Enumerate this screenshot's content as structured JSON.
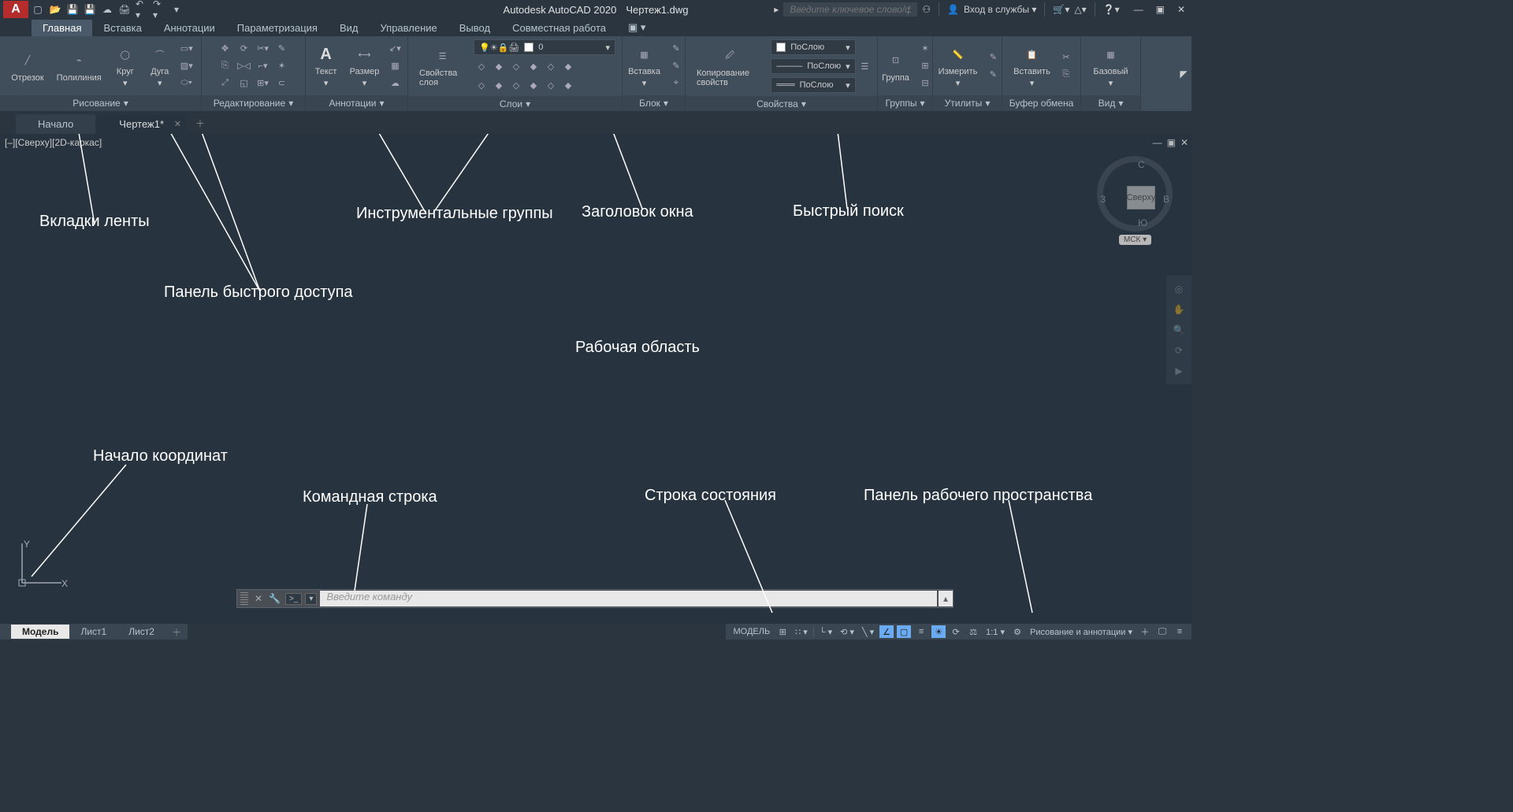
{
  "title": {
    "app": "Autodesk AutoCAD 2020",
    "file": "Чертеж1.dwg"
  },
  "search": {
    "placeholder": "Введите ключевое слово/фразу"
  },
  "login": "Вход в службы ▾",
  "ribbon_tabs": [
    "Главная",
    "Вставка",
    "Аннотации",
    "Параметризация",
    "Вид",
    "Управление",
    "Вывод",
    "Совместная работа"
  ],
  "panels": {
    "draw": {
      "title": "Рисование",
      "items": [
        "Отрезок",
        "Полилиния",
        "Круг",
        "Дуга"
      ]
    },
    "edit": {
      "title": "Редактирование"
    },
    "annot": {
      "title": "Аннотации",
      "items": [
        "Текст",
        "Размер"
      ]
    },
    "layers": {
      "title": "Слои",
      "props": "Свойства слоя",
      "layer": "0"
    },
    "block": {
      "title": "Блок",
      "item": "Вставка"
    },
    "props": {
      "title": "Свойства",
      "copy": "Копирование свойств",
      "bylayer": "ПоСлою"
    },
    "groups": {
      "title": "Группы",
      "item": "Группа"
    },
    "util": {
      "title": "Утилиты",
      "item": "Измерить"
    },
    "clip": {
      "title": "Буфер обмена",
      "item": "Вставить"
    },
    "view": {
      "title": "Вид",
      "item": "Базовый"
    }
  },
  "filetabs": {
    "start": "Начало",
    "file": "Чертеж1*"
  },
  "viewport": {
    "label": "[–][Сверху][2D-каркас]"
  },
  "viewcube": {
    "face": "Сверху",
    "n": "С",
    "e": "В",
    "s": "Ю",
    "w": "З",
    "wcs": "МСК ▾"
  },
  "ucs": {
    "x": "X",
    "y": "Y"
  },
  "cmd": {
    "placeholder": "Введите команду"
  },
  "btabs": {
    "model": "Модель",
    "l1": "Лист1",
    "l2": "Лист2"
  },
  "status": {
    "model": "МОДЕЛЬ",
    "scale": "1:1 ▾",
    "ws": "Рисование и аннотации ▾"
  },
  "annotations": {
    "ribbon_tabs": "Вкладки ленты",
    "qat": "Панель быстрого доступа",
    "panels": "Инструментальные группы",
    "title": "Заголовок окна",
    "search": "Быстрый поиск",
    "workarea": "Рабочая область",
    "origin": "Начало координат",
    "cmd": "Командная строка",
    "status": "Строка состояния",
    "workspace": "Панель рабочего пространства"
  }
}
